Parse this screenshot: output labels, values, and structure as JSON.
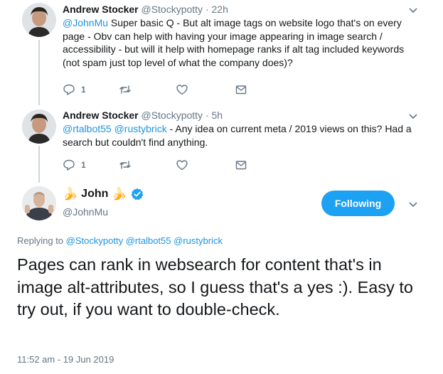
{
  "tweets": [
    {
      "name": "Andrew Stocker",
      "handle": "@Stockypotty",
      "time": "· 22h",
      "mention": "@JohnMu",
      "text": " Super basic Q - But alt image tags on website logo that's on every page - Obv can help with having your image appearing in image search / accessibility - but will it help with homepage ranks if alt tag included keywords (not spam just top level of what the company does)?",
      "reply_count": "1",
      "icons": [
        "reply-icon",
        "retweet-icon",
        "like-icon",
        "message-icon"
      ]
    },
    {
      "name": "Andrew Stocker",
      "handle": "@Stockypotty",
      "time": "· 5h",
      "mentions": [
        "@rtalbot55",
        "@rustybrick"
      ],
      "text": " - Any idea on current meta / 2019 views on this? Had a search but couldn't find anything.",
      "reply_count": "1",
      "icons": [
        "reply-icon",
        "retweet-icon",
        "like-icon",
        "message-icon"
      ]
    }
  ],
  "main": {
    "name_emoji": "🍌",
    "name": "John",
    "handle": "@JohnMu",
    "verified": true,
    "follow_label": "Following",
    "replying_prefix": "Replying to",
    "replying_to": [
      "@Stockypotty",
      "@rtalbot55",
      "@rustybrick"
    ],
    "text": "Pages can rank in websearch for content that's in image alt-attributes, so I guess that's a yes :). Easy to try out, if you want to double-check.",
    "timestamp": "11:52 am - 19 Jun 2019"
  },
  "colors": {
    "accent": "#1da1f2",
    "mention": "#1b95e0",
    "muted": "#657786",
    "text": "#14171a"
  }
}
